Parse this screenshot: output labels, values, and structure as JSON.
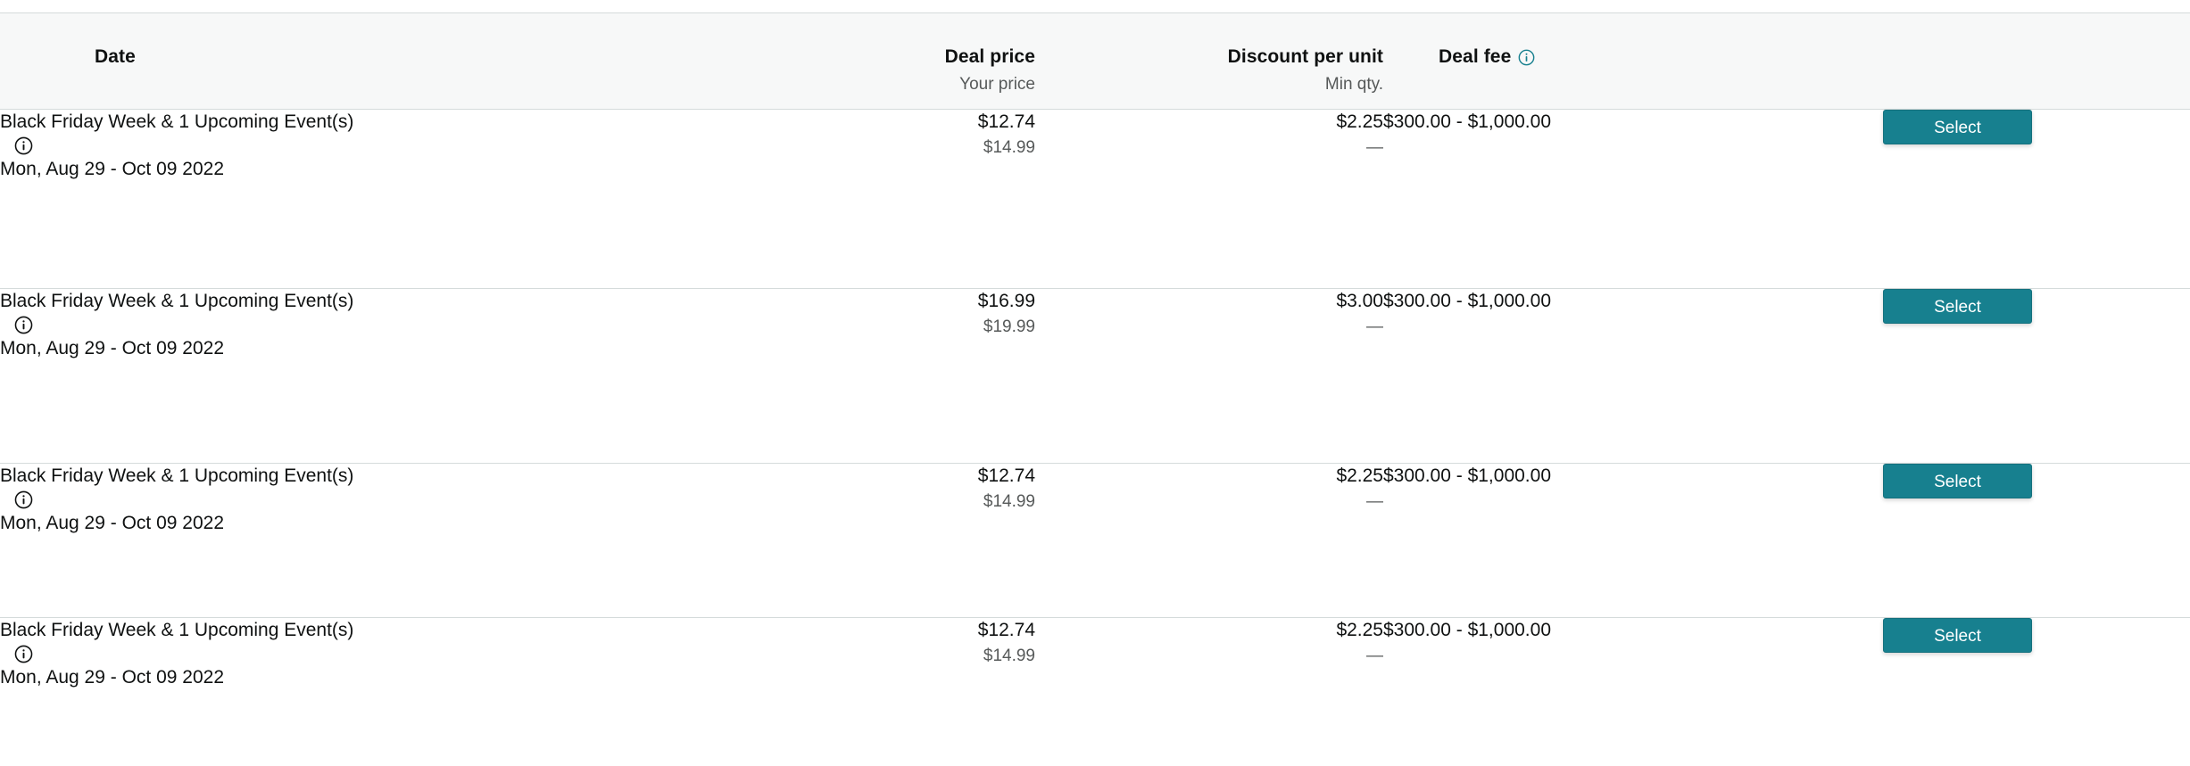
{
  "table": {
    "columns": [
      {
        "id": "date",
        "title": "Date",
        "subtitle": ""
      },
      {
        "id": "dealprice",
        "title": "Deal price",
        "subtitle": "Your price"
      },
      {
        "id": "discount",
        "title": "Discount per unit",
        "subtitle": "Min qty."
      },
      {
        "id": "dealfee",
        "title": "Deal fee",
        "subtitle": "",
        "info_icon": "info-circle-icon"
      },
      {
        "id": "action",
        "title": "",
        "subtitle": ""
      }
    ],
    "rows": [
      {
        "event_name": "Black Friday Week & 1 Upcoming Event(s)",
        "info_icon": "info-circle-icon",
        "date_range": "Mon, Aug 29 - Oct 09 2022",
        "deal_price": "$12.74",
        "your_price": "$14.99",
        "discount_per_unit": "$2.25",
        "min_qty": "—",
        "deal_fee": "$300.00 - $1,000.00",
        "action_label": "Select"
      },
      {
        "event_name": "Black Friday Week & 1 Upcoming Event(s)",
        "info_icon": "info-circle-icon",
        "date_range": "Mon, Aug 29 - Oct 09 2022",
        "deal_price": "$16.99",
        "your_price": "$19.99",
        "discount_per_unit": "$3.00",
        "min_qty": "—",
        "deal_fee": "$300.00 - $1,000.00",
        "action_label": "Select"
      },
      {
        "event_name": "Black Friday Week & 1 Upcoming Event(s)",
        "info_icon": "info-circle-icon",
        "date_range": "Mon, Aug 29 - Oct 09 2022",
        "deal_price": "$12.74",
        "your_price": "$14.99",
        "discount_per_unit": "$2.25",
        "min_qty": "—",
        "deal_fee": "$300.00 - $1,000.00",
        "action_label": "Select"
      },
      {
        "event_name": "Black Friday Week & 1 Upcoming Event(s)",
        "info_icon": "info-circle-icon",
        "date_range": "Mon, Aug 29 - Oct 09 2022",
        "deal_price": "$12.74",
        "your_price": "$14.99",
        "discount_per_unit": "$2.25",
        "min_qty": "—",
        "deal_fee": "$300.00 - $1,000.00",
        "action_label": "Select"
      }
    ]
  },
  "colors": {
    "header_background": "#f7f8f8",
    "border": "#d5dbdb",
    "button_teal": "#17808f",
    "text_primary": "#0f1111",
    "text_secondary": "#565959",
    "info_icon_accent": "#17808f"
  }
}
